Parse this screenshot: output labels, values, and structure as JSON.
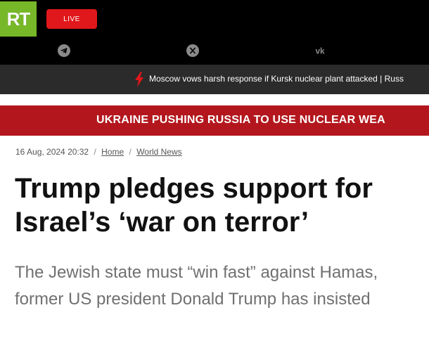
{
  "header": {
    "logo_text": "RT",
    "live_label": "LIVE",
    "social_icons": [
      "telegram-icon",
      "x-icon",
      "vk-icon"
    ],
    "colors": {
      "logo_bg": "#77b828",
      "live_bg": "#e0171b",
      "bar_bg": "#000000"
    }
  },
  "ticker": {
    "text": "Moscow vows harsh response if Kursk nuclear plant attacked | Russ",
    "icon": "lightning-icon"
  },
  "banner": {
    "text": "UKRAINE PUSHING RUSSIA TO USE NUCLEAR WEA",
    "color": "#b3171d"
  },
  "article": {
    "date": "16 Aug, 2024 20:32",
    "breadcrumb": [
      "Home",
      "World News"
    ],
    "separator": "/",
    "title": "Trump pledges support for Israel’s ‘war on terror’",
    "summary": "The Jewish state must “win fast” against Hamas, former US president Donald Trump has insisted"
  }
}
